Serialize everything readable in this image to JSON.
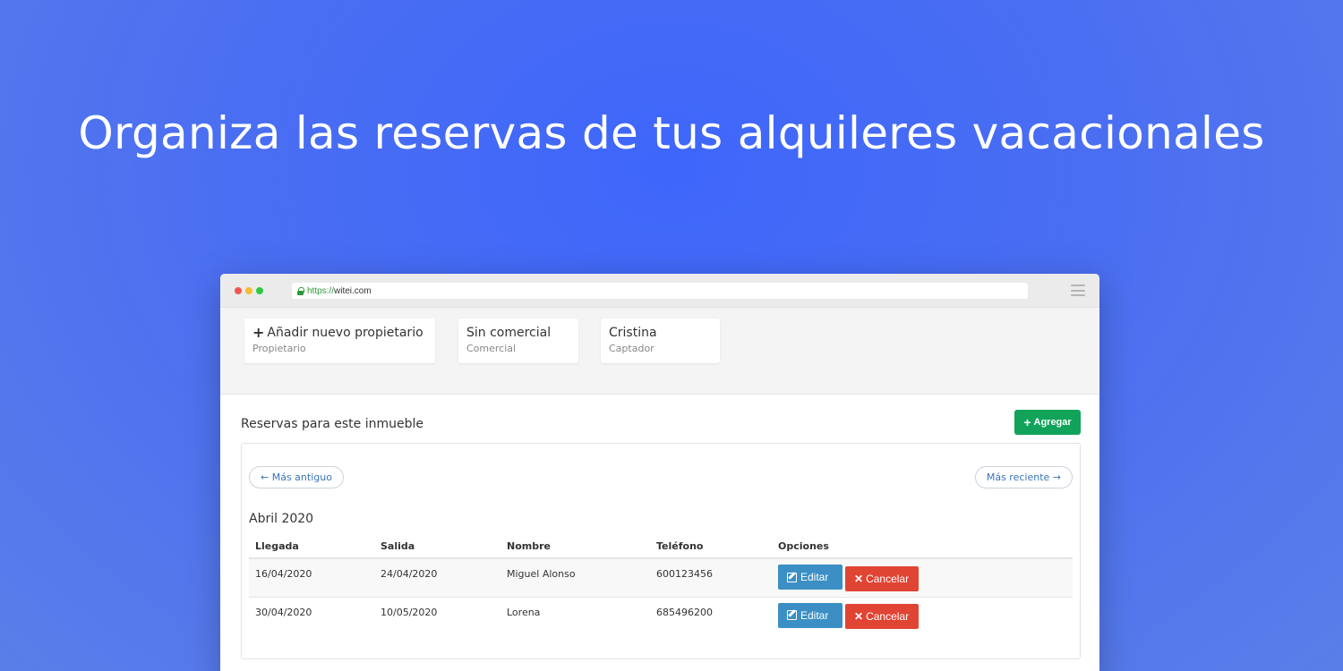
{
  "hero": {
    "title": "Organiza las reservas de tus alquileres vacacionales"
  },
  "browser": {
    "url_scheme": "https://",
    "url_host": "witei.com"
  },
  "cards": [
    {
      "title": "Añadir nuevo propietario",
      "subtitle": "Propietario"
    },
    {
      "title": "Sin comercial",
      "subtitle": "Comercial"
    },
    {
      "title": "Cristina",
      "subtitle": "Captador"
    }
  ],
  "panel": {
    "title": "Reservas para este inmueble",
    "add_label": "Agregar",
    "prev_label": "← Más antiguo",
    "next_label": "Más reciente →",
    "month": "Abril 2020"
  },
  "table": {
    "headers": [
      "Llegada",
      "Salida",
      "Nombre",
      "Teléfono",
      "Opciones"
    ],
    "rows": [
      {
        "llegada": "16/04/2020",
        "salida": "24/04/2020",
        "nombre": "Miguel Alonso",
        "telefono": "600123456",
        "edit": "Editar",
        "cancel": "Cancelar"
      },
      {
        "llegada": "30/04/2020",
        "salida": "10/05/2020",
        "nombre": "Lorena",
        "telefono": "685496200",
        "edit": "Editar",
        "cancel": "Cancelar"
      }
    ]
  },
  "colors": {
    "background": "#3e66fb",
    "add_button": "#11a35a",
    "edit_button": "#3b8fc4",
    "cancel_button": "#e04433",
    "link": "#3a74b8"
  }
}
